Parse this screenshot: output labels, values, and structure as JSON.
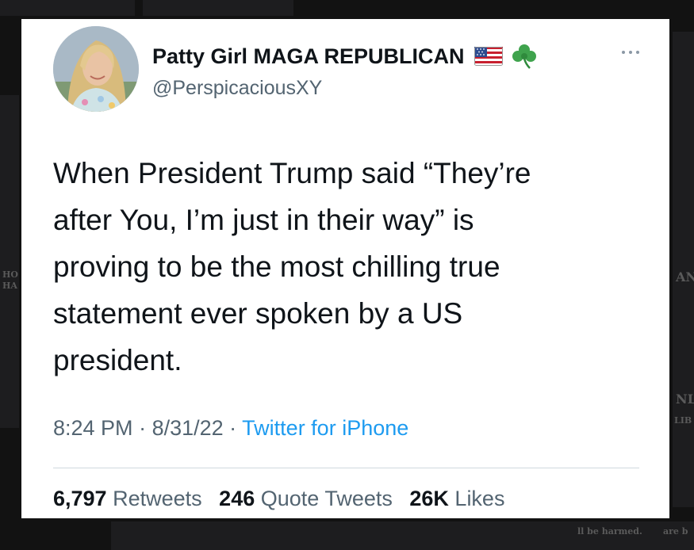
{
  "profile": {
    "display_name": "Patty Girl MAGA REPUBLICAN",
    "handle": "@PerspicaciousXY",
    "badges": [
      "us-flag-icon",
      "shamrock-icon"
    ]
  },
  "tweet": {
    "text": "When President Trump said “They’re\nafter You, I’m just in their way” is\nproving to be the most chilling true\nstatement ever spoken by a US\npresident.",
    "time": "8:24 PM",
    "separator1": " · ",
    "date": "8/31/22",
    "separator2": " · ",
    "source": "Twitter for iPhone"
  },
  "stats": {
    "retweets_count": "6,797",
    "retweets_label": "Retweets",
    "quote_count": "246",
    "quote_label": "Quote Tweets",
    "likes_count": "26K",
    "likes_label": "Likes"
  },
  "background_fragments": [
    "HO",
    "HA",
    "AN",
    "NL",
    "LIB",
    "ll be harmed.",
    "are b"
  ],
  "colors": {
    "accent": "#1d9bf0",
    "text_primary": "#0f1419",
    "text_secondary": "#536471",
    "backdrop": "#121212"
  }
}
